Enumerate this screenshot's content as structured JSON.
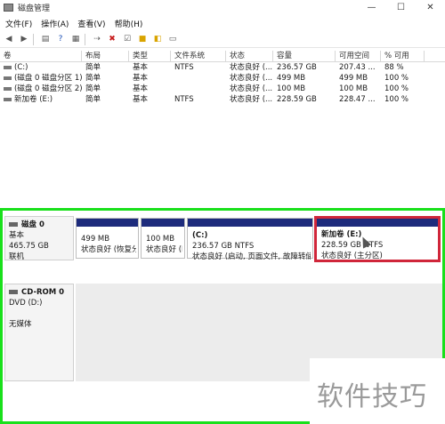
{
  "window": {
    "title": "磁盘管理",
    "minimize": "—",
    "maximize": "☐",
    "close": "✕"
  },
  "menu": [
    "文件(F)",
    "操作(A)",
    "查看(V)",
    "帮助(H)"
  ],
  "columns": [
    "卷",
    "布局",
    "类型",
    "文件系统",
    "状态",
    "容量",
    "可用空间",
    "% 可用"
  ],
  "volumes": [
    {
      "name": "(C:)",
      "layout": "简单",
      "type": "基本",
      "fs": "NTFS",
      "status": "状态良好 (...",
      "capacity": "236.57 GB",
      "free": "207.43 ...",
      "pct": "88 %"
    },
    {
      "name": "(磁盘 0 磁盘分区 1)",
      "layout": "简单",
      "type": "基本",
      "fs": "",
      "status": "状态良好 (...",
      "capacity": "499 MB",
      "free": "499 MB",
      "pct": "100 %"
    },
    {
      "name": "(磁盘 0 磁盘分区 2)",
      "layout": "简单",
      "type": "基本",
      "fs": "",
      "status": "状态良好 (...",
      "capacity": "100 MB",
      "free": "100 MB",
      "pct": "100 %"
    },
    {
      "name": "新加卷 (E:)",
      "layout": "简单",
      "type": "基本",
      "fs": "NTFS",
      "status": "状态良好 (...",
      "capacity": "228.59 GB",
      "free": "228.47 ...",
      "pct": "100 %"
    }
  ],
  "disk0": {
    "name": "磁盘 0",
    "type": "基本",
    "size": "465.75 GB",
    "state": "联机",
    "partitions": [
      {
        "line1": "499 MB",
        "line2": "状态良好 (恢复分"
      },
      {
        "line1": "100 MB",
        "line2": "状态良好 (E"
      },
      {
        "title": "(C:)",
        "line1": "236.57 GB NTFS",
        "line2": "状态良好 (启动, 页面文件, 故障转储"
      },
      {
        "title": "新加卷  (E:)",
        "line1": "228.59 GB NTFS",
        "line2": "状态良好 (主分区)"
      }
    ]
  },
  "cdrom": {
    "name": "CD-ROM 0",
    "drive": "DVD (D:)",
    "media": "无媒体"
  },
  "watermark": "软件技巧",
  "colors": {
    "highlight_green": "#19e01b",
    "highlight_red": "#d0263a",
    "partition_stripe": "#1d2b7c"
  }
}
